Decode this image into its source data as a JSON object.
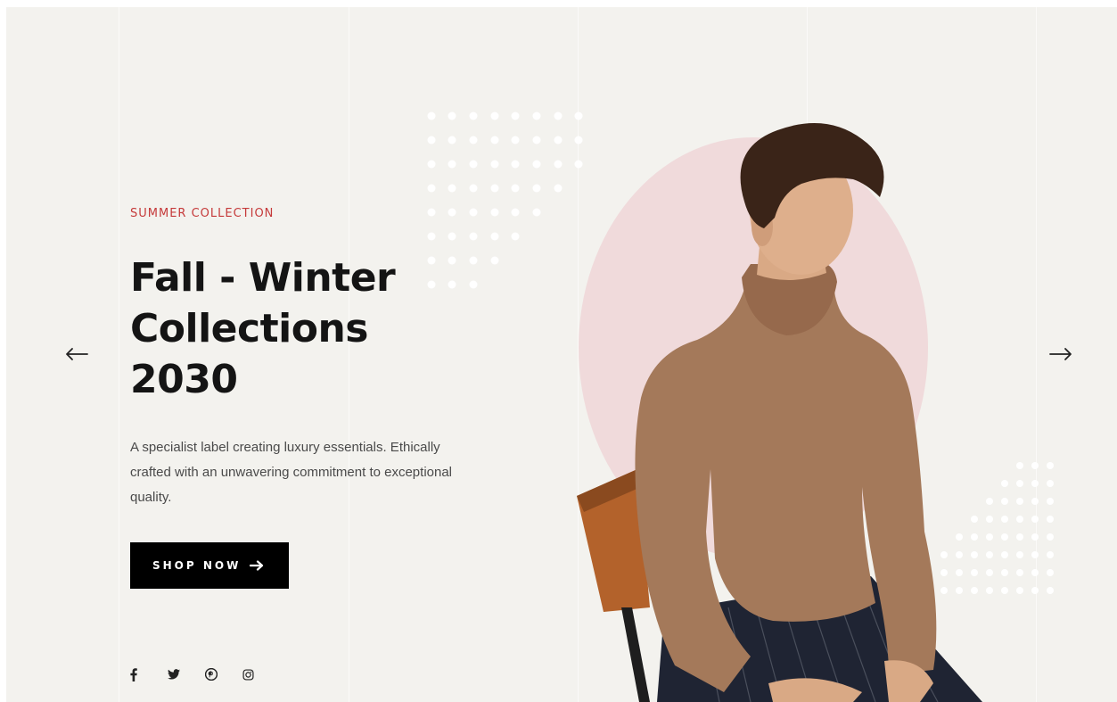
{
  "hero": {
    "kicker": "Summer Collection",
    "title_line1": "Fall - Winter",
    "title_line2": "Collections 2030",
    "description": "A specialist label creating luxury essentials. Ethically crafted with an unwavering commitment to exceptional quality.",
    "cta_label": "Shop now",
    "cta_icon": "arrow-right-icon"
  },
  "navigation": {
    "prev_icon": "arrow-left-icon",
    "next_icon": "arrow-right-icon"
  },
  "social": [
    {
      "name": "facebook",
      "icon": "facebook-icon"
    },
    {
      "name": "twitter",
      "icon": "twitter-icon"
    },
    {
      "name": "pinterest",
      "icon": "pinterest-icon"
    },
    {
      "name": "instagram",
      "icon": "instagram-icon"
    }
  ],
  "colors": {
    "background": "#f3f2ee",
    "accent": "#c53a3a",
    "circle": "#f0dadb",
    "button": "#000000",
    "sweater": "#a4795a"
  }
}
